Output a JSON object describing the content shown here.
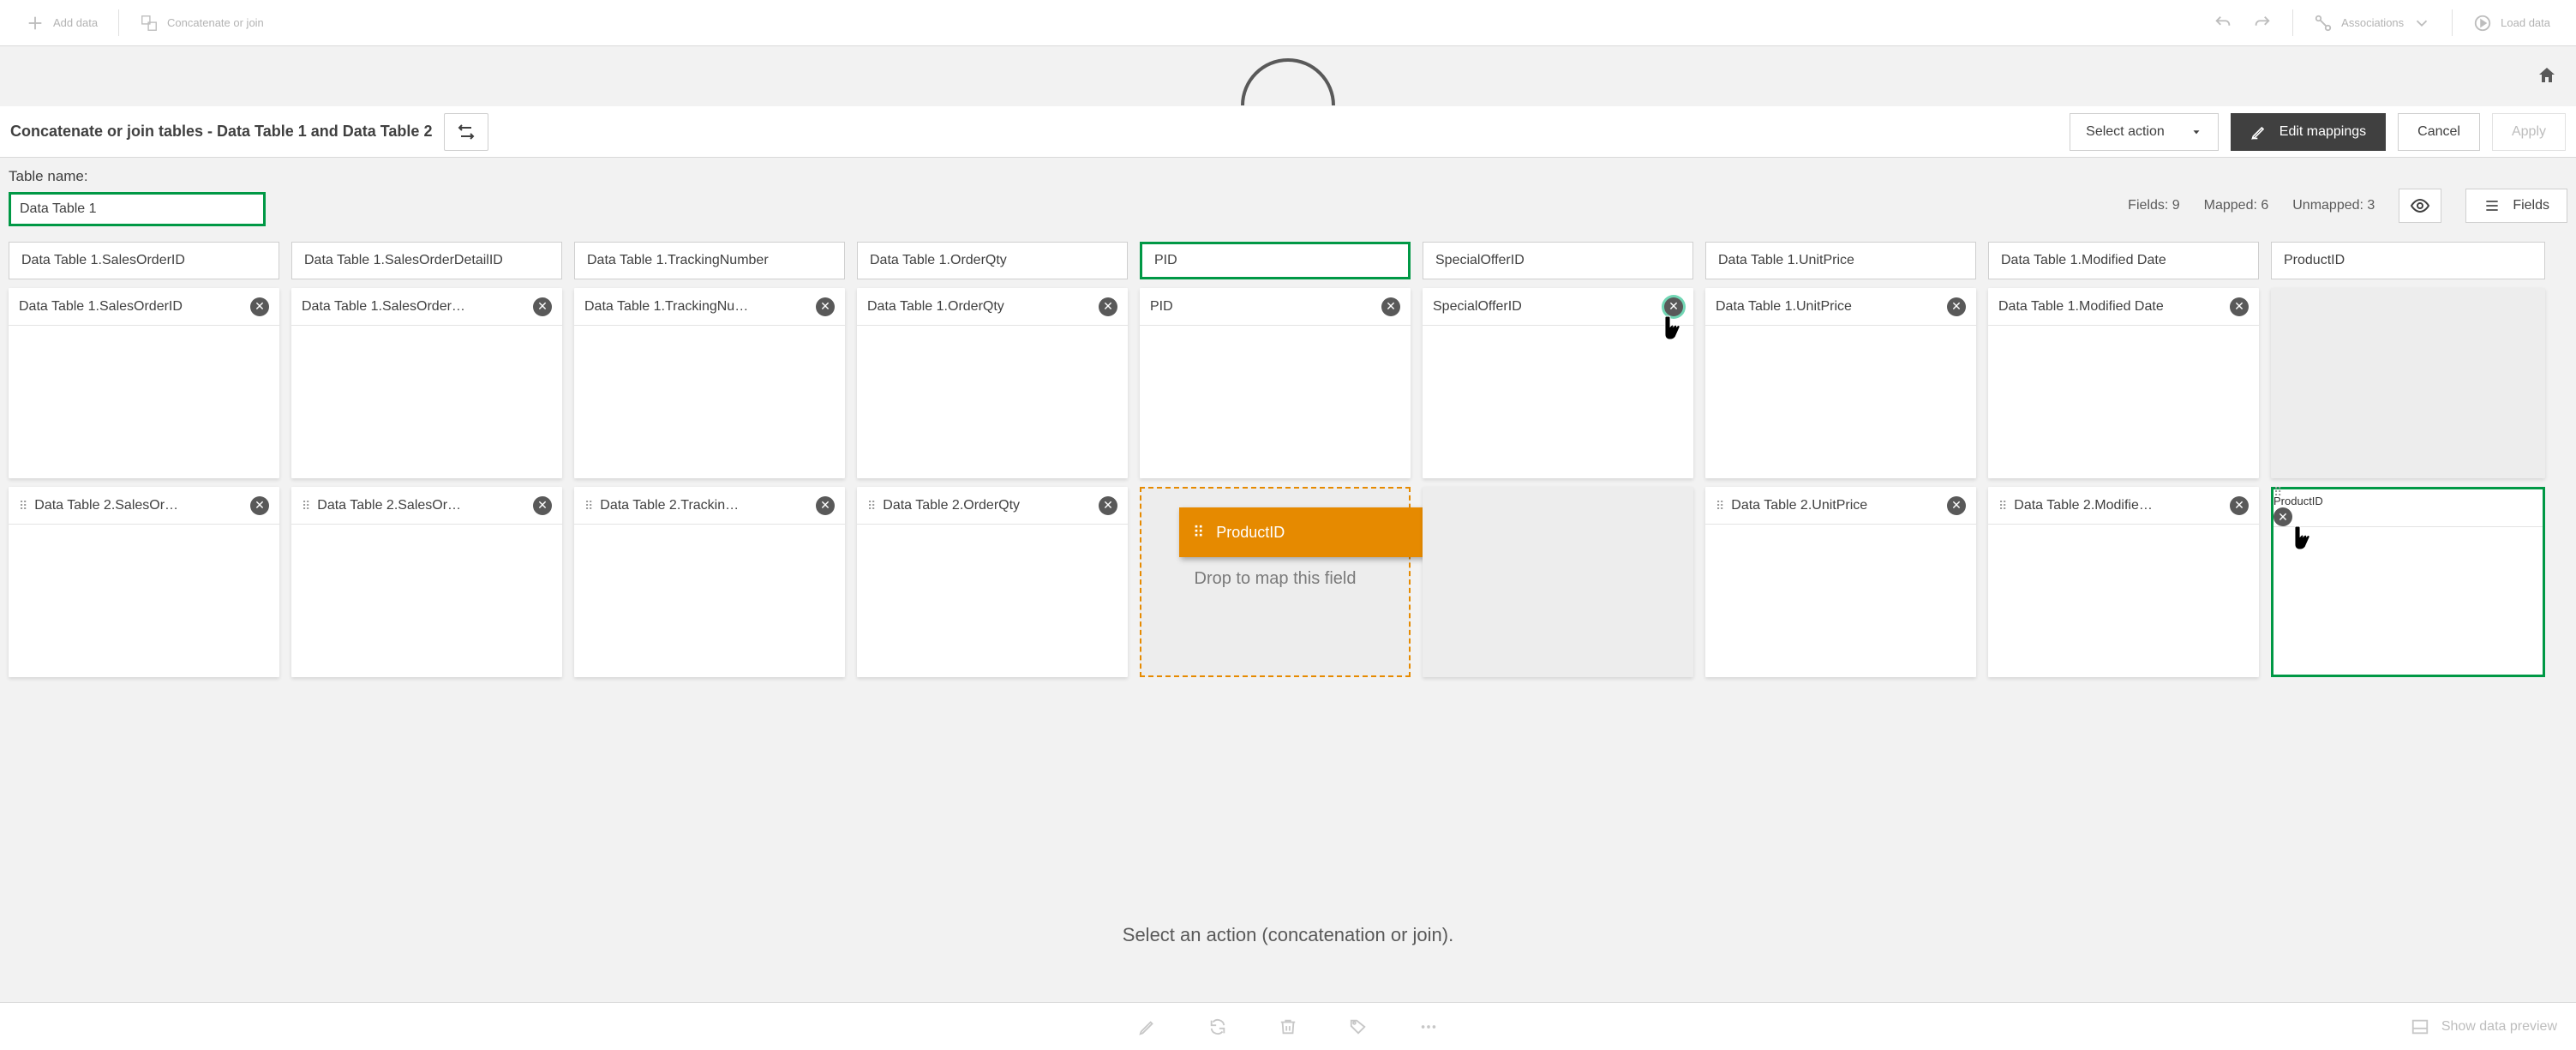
{
  "topbar": {
    "add_data": "Add data",
    "concat_join": "Concatenate or join",
    "associations": "Associations",
    "load_data": "Load data"
  },
  "header": {
    "title": "Concatenate or join tables - Data Table 1 and Data Table 2",
    "select_action": "Select action",
    "edit_mappings": "Edit mappings",
    "cancel": "Cancel",
    "apply": "Apply"
  },
  "subheader": {
    "table_name_label": "Table name:",
    "table_name_value": "Data Table 1",
    "fields_label": "Fields: 9",
    "mapped_label": "Mapped: 6",
    "unmapped_label": "Unmapped: 3",
    "fields_btn": "Fields"
  },
  "columns": [
    {
      "head": "Data Table 1.SalesOrderID",
      "top": "Data Table 1.SalesOrderID",
      "bot": "Data Table 2.SalesOr…"
    },
    {
      "head": "Data Table 1.SalesOrderDetailID",
      "top": "Data Table 1.SalesOrder…",
      "bot": "Data Table 2.SalesOr…"
    },
    {
      "head": "Data Table 1.TrackingNumber",
      "top": "Data Table 1.TrackingNu…",
      "bot": "Data Table 2.Trackin…"
    },
    {
      "head": "Data Table 1.OrderQty",
      "top": "Data Table 1.OrderQty",
      "bot": "Data Table 2.OrderQty"
    },
    {
      "head": "PID",
      "top": "PID"
    },
    {
      "head": "SpecialOfferID",
      "top": "SpecialOfferID"
    },
    {
      "head": "Data Table 1.UnitPrice",
      "top": "Data Table 1.UnitPrice",
      "bot": "Data Table 2.UnitPrice"
    },
    {
      "head": "Data Table 1.Modified Date",
      "top": "Data Table 1.Modified Date",
      "bot": "Data Table 2.Modifie…"
    },
    {
      "head": "ProductID",
      "bot": "ProductID"
    }
  ],
  "drag_chip": "ProductID",
  "drop_hint": "Drop to map this field",
  "instruction": "Select an action (concatenation or join).",
  "footer_preview": "Show data preview"
}
